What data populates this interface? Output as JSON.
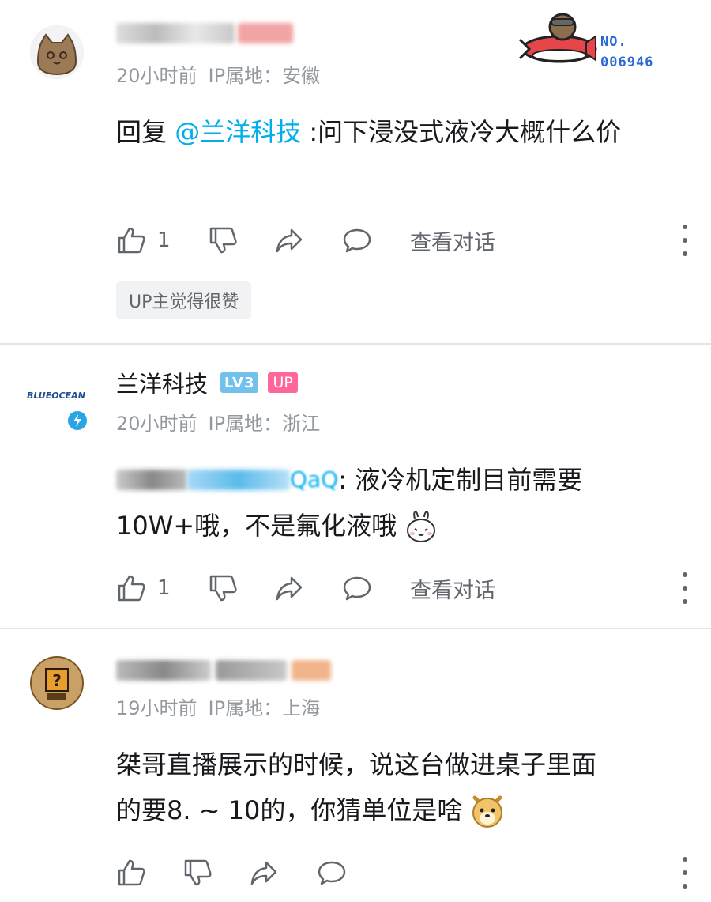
{
  "comments": [
    {
      "time": "20小时前",
      "ip": "IP属地：安徽",
      "reply_prefix": "回复 ",
      "mention": "@兰洋科技",
      "text": " :问下浸没式液冷大概什么价",
      "likes": "1",
      "view_conversation": "查看对话",
      "up_badge": "UP主觉得很赞",
      "decoration_number": "NO.\n006946"
    },
    {
      "username": "兰洋科技",
      "level": "LV3",
      "up_tag": "UP",
      "avatar_text": "BLUEOCEAN",
      "time": "20小时前",
      "ip": "IP属地：浙江",
      "reply_target_tail": "QaQ",
      "text_line1": " : 液冷机定制目前需要",
      "text_line2": "10W+哦，不是氟化液哦",
      "likes": "1",
      "view_conversation": "查看对话"
    },
    {
      "time": "19小时前",
      "ip": "IP属地：上海",
      "text_line1": "桀哥直播展示的时候，说这台做进桌子里面",
      "text_line2": "的要8. ~ 10的，你猜单位是啥"
    }
  ],
  "colors": {
    "mention": "#00aeec",
    "meta": "#9499a0",
    "level_badge": "#71c1ec",
    "up_tag": "#ff6699"
  }
}
